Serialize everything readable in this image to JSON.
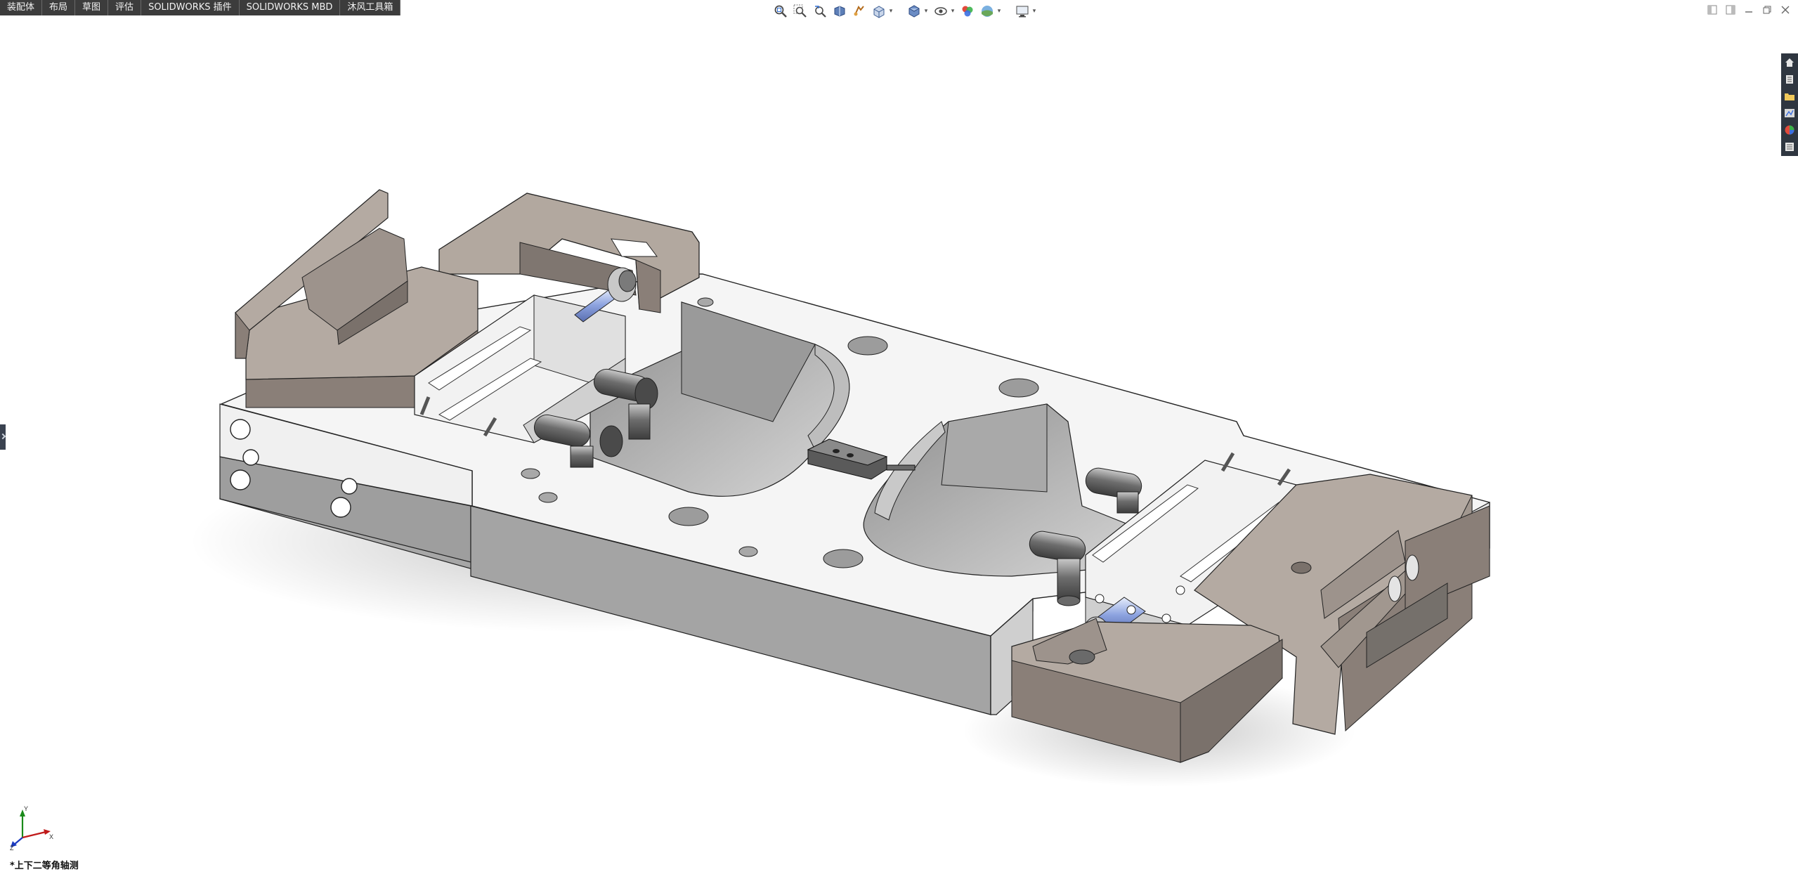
{
  "command_manager": {
    "tabs": [
      {
        "label": "装配体"
      },
      {
        "label": "布局"
      },
      {
        "label": "草图"
      },
      {
        "label": "评估"
      },
      {
        "label": "SOLIDWORKS 插件"
      },
      {
        "label": "SOLIDWORKS MBD"
      },
      {
        "label": "沐风工具箱"
      }
    ]
  },
  "heads_up_toolbar": {
    "icons": [
      "zoom-to-fit-icon",
      "zoom-to-area-icon",
      "previous-view-icon",
      "section-view-icon",
      "dynamic-annotation-views-icon",
      "view-orientation-icon",
      "display-style-icon",
      "hide-show-items-icon",
      "edit-appearance-icon",
      "apply-scene-icon",
      "view-settings-icon"
    ]
  },
  "window_controls": {
    "icons": [
      "tile-left-icon",
      "tile-right-icon",
      "minimize-icon",
      "restore-icon",
      "close-icon"
    ]
  },
  "task_pane": {
    "icons": [
      "solidworks-resources-icon",
      "design-library-icon",
      "file-explorer-icon",
      "view-palette-icon",
      "appearances-scenes-icon",
      "custom-properties-icon"
    ]
  },
  "viewport": {
    "view_orientation_label": "*上下二等角轴测",
    "triad": {
      "x_label": "X",
      "y_label": "Y",
      "z_label": "Z"
    }
  },
  "colors": {
    "tab_bar_bg": "#3c3c3c",
    "part_white": "#f4f4f4",
    "part_gray": "#a9a9a9",
    "part_taupe": "#8a7f78",
    "part_taupe_light": "#b4aaa2",
    "accent_blue": "#8da3e0"
  }
}
